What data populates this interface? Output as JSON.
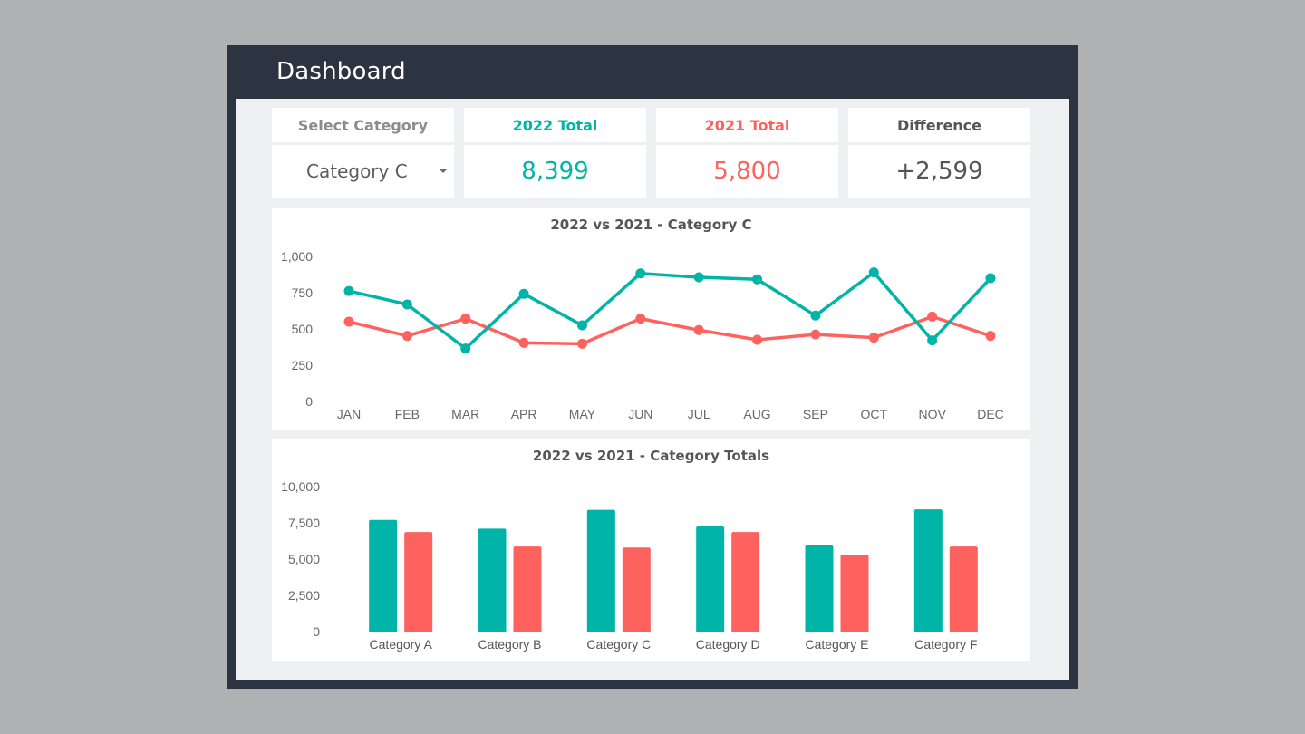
{
  "header": {
    "title": "Dashboard"
  },
  "colors": {
    "series_2022": "#00b5a8",
    "series_2021": "#fd625e",
    "neutral": "#555555",
    "muted": "#8c8c8c"
  },
  "kpis": {
    "select": {
      "label": "Select Category",
      "value": "Category C"
    },
    "total_2022": {
      "label": "2022 Total",
      "value": "8,399"
    },
    "total_2021": {
      "label": "2021 Total",
      "value": "5,800"
    },
    "difference": {
      "label": "Difference",
      "value": "+2,599"
    }
  },
  "chart_data": [
    {
      "type": "line",
      "title": "2022 vs 2021 - Category C",
      "xlabel": "",
      "ylabel": "",
      "categories": [
        "JAN",
        "FEB",
        "MAR",
        "APR",
        "MAY",
        "JUN",
        "JUL",
        "AUG",
        "SEP",
        "OCT",
        "NOV",
        "DEC"
      ],
      "yticks": [
        "0",
        "250",
        "500",
        "750",
        "1,000"
      ],
      "ylim": [
        0,
        1000
      ],
      "grid": false,
      "legend": "none",
      "series": [
        {
          "name": "2022",
          "color": "#00b5a8",
          "values": [
            762,
            669,
            365,
            742,
            525,
            883,
            856,
            842,
            592,
            890,
            421,
            850
          ]
        },
        {
          "name": "2021",
          "color": "#fd625e",
          "values": [
            550,
            452,
            571,
            404,
            398,
            571,
            492,
            425,
            462,
            440,
            585,
            452
          ]
        }
      ]
    },
    {
      "type": "bar",
      "title": "2022 vs 2021 - Category Totals",
      "xlabel": "",
      "ylabel": "",
      "categories": [
        "Category A",
        "Category B",
        "Category C",
        "Category D",
        "Category E",
        "Category F"
      ],
      "yticks": [
        "0",
        "2,500",
        "5,000",
        "7,500",
        "10,000"
      ],
      "ylim": [
        0,
        10000
      ],
      "grid": false,
      "legend": "none",
      "series": [
        {
          "name": "2022",
          "color": "#00b5a8",
          "values": [
            7700,
            7100,
            8399,
            7250,
            6000,
            8430
          ]
        },
        {
          "name": "2021",
          "color": "#fd625e",
          "values": [
            6870,
            5870,
            5800,
            6870,
            5300,
            5870
          ]
        }
      ]
    }
  ]
}
